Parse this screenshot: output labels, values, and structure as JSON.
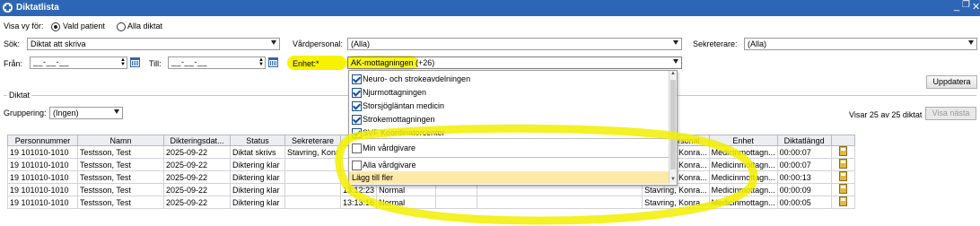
{
  "window": {
    "title": "Diktatlista",
    "min_icon": "minimize-icon",
    "restore_icon": "restore-icon",
    "close_icon": "close-icon"
  },
  "view": {
    "label": "Visa vy för:",
    "options": [
      {
        "label": "Vald patient",
        "checked": true
      },
      {
        "label": "Alla diktat",
        "checked": false
      }
    ]
  },
  "search": {
    "label": "Sök:",
    "value": "Diktat att skriva"
  },
  "staff": {
    "label": "Vårdpersonal:",
    "value": "(Alla)"
  },
  "secretary": {
    "label": "Sekreterare:",
    "value": "(Alla)"
  },
  "from": {
    "label": "Från:",
    "value": "__-__-__"
  },
  "to": {
    "label": "Till:",
    "value": "__-__-__"
  },
  "unit": {
    "label": "Enhet:*",
    "value": "AK-mottagningen (+26)"
  },
  "dropdown": {
    "items": [
      {
        "label": "Neuro- och strokeavdelningen",
        "checked": true
      },
      {
        "label": "Njurmottagningen",
        "checked": true
      },
      {
        "label": "Storsjögläntan medicin",
        "checked": true
      },
      {
        "label": "Strokemottagningen",
        "checked": true
      },
      {
        "label": "SVF Koordinatorcenter",
        "checked": true
      }
    ],
    "my_caregiver": "Min vårdgivare",
    "all_caregivers": "Alla vårdgivare",
    "add_more": "Lägg till fler"
  },
  "update_button": "Uppdatera",
  "section_title": "Diktat",
  "grouping": {
    "label": "Gruppering:",
    "value": "(Ingen)"
  },
  "paging": {
    "text": "Visar 25 av 25 diktat",
    "next_button": "Visa nästa"
  },
  "table": {
    "columns": [
      "Personnummer",
      "Namn",
      "Dikteringsdat...",
      "Status",
      "Sekreterare",
      "",
      "",
      "",
      "",
      "Vårdpersonal",
      "Enhet",
      "Diktatlängd",
      ""
    ],
    "rows": [
      [
        "19 101010-1010",
        "Testsson, Test",
        "2025-09-22",
        "Diktat skrivs",
        "Stavring, Konr",
        "",
        "",
        "",
        "",
        "Stavring, Konra...",
        "Medicinmottagn...",
        "00:00:07"
      ],
      [
        "19 101010-1010",
        "Testsson, Test",
        "2025-09-22",
        "Diktering klar",
        "",
        "",
        "",
        "",
        "",
        "Stavring, Konra...",
        "Medicinmottagn...",
        "00:00:07"
      ],
      [
        "19 101010-1010",
        "Testsson, Test",
        "2025-09-22",
        "Diktering klar",
        "",
        "",
        "",
        "",
        "",
        "Stavring, Konra...",
        "Medicinmottagn...",
        "00:00:13"
      ],
      [
        "19 101010-1010",
        "Testsson, Test",
        "2025-09-22",
        "Diktering klar",
        "",
        "13:12:23",
        "Normal",
        "",
        "",
        "Stavring, Konra...",
        "Medicinmottagn...",
        "00:00:09"
      ],
      [
        "19 101010-1010",
        "Testsson, Test",
        "2025-09-22",
        "Diktering klar",
        "",
        "13:13:16",
        "Normal",
        "",
        "",
        "Stavring, Konra...",
        "Medicinmottagn...",
        "00:00:05"
      ]
    ]
  },
  "colors": {
    "titlebar": "#2d66b5",
    "highlight": "#f7f300"
  }
}
